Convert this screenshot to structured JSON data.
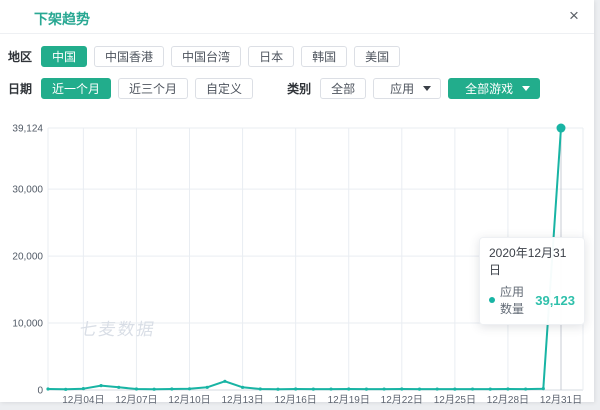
{
  "header": {
    "title": "下架趋势",
    "close_label": "×"
  },
  "filters": {
    "region": {
      "label": "地区",
      "options": [
        "中国",
        "中国香港",
        "中国台湾",
        "日本",
        "韩国",
        "美国"
      ],
      "selected": "中国"
    },
    "date": {
      "label": "日期",
      "options": [
        "近一个月",
        "近三个月",
        "自定义"
      ],
      "selected": "近一个月"
    },
    "category": {
      "label": "类别",
      "all_button": "全部",
      "type_dropdown": "应用",
      "game_dropdown": "全部游戏"
    }
  },
  "tooltip": {
    "date": "2020年12月31日",
    "series": "应用数量",
    "value": "39,123"
  },
  "watermark": {
    "text": "七麦数据"
  },
  "colors": {
    "accent": "#22ad8c",
    "line": "#18b4a4",
    "tooltip_value": "#2fc0ab",
    "grid": "#e9edf2",
    "axis": "#d6dbe2",
    "crosshair": "#c8ccd4"
  },
  "chart_data": {
    "type": "line",
    "title": "下架趋势",
    "xlabel": "",
    "ylabel": "",
    "x": [
      "12月02日",
      "12月03日",
      "12月04日",
      "12月05日",
      "12月06日",
      "12月07日",
      "12月08日",
      "12月09日",
      "12月10日",
      "12月11日",
      "12月12日",
      "12月13日",
      "12月14日",
      "12月15日",
      "12月16日",
      "12月17日",
      "12月18日",
      "12月19日",
      "12月20日",
      "12月21日",
      "12月22日",
      "12月23日",
      "12月24日",
      "12月25日",
      "12月26日",
      "12月27日",
      "12月28日",
      "12月29日",
      "12月30日",
      "12月31日"
    ],
    "series": [
      {
        "name": "应用数量",
        "values": [
          150,
          100,
          200,
          650,
          400,
          150,
          120,
          150,
          180,
          400,
          1300,
          400,
          150,
          120,
          150,
          130,
          140,
          150,
          130,
          140,
          150,
          130,
          140,
          130,
          140,
          130,
          150,
          140,
          200,
          39123
        ]
      }
    ],
    "x_tick_labels": [
      "12月04日",
      "12月07日",
      "12月10日",
      "12月13日",
      "12月16日",
      "12月19日",
      "12月22日",
      "12月25日",
      "12月28日",
      "12月31日"
    ],
    "y_ticks": [
      {
        "value": 0,
        "label": "0"
      },
      {
        "value": 10000,
        "label": "10,000"
      },
      {
        "value": 20000,
        "label": "20,000"
      },
      {
        "value": 30000,
        "label": "30,000"
      },
      {
        "value": 39124,
        "label": "39,124"
      }
    ],
    "ylim": [
      0,
      39124
    ],
    "grid": true,
    "legend_position": "none",
    "highlight_index": 29
  }
}
